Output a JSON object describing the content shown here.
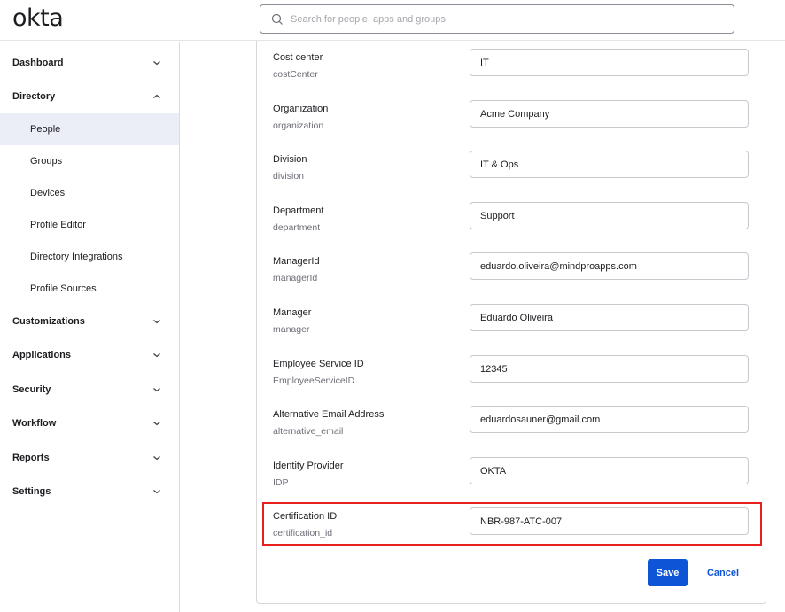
{
  "header": {
    "logo_text": "okta",
    "search": {
      "placeholder": "Search for people, apps and groups",
      "value": ""
    }
  },
  "sidebar": {
    "sections": [
      {
        "label": "Dashboard",
        "expanded": false,
        "icon": "chevron-down-icon"
      },
      {
        "label": "Directory",
        "expanded": true,
        "icon": "chevron-up-icon",
        "items": [
          {
            "label": "People",
            "active": true
          },
          {
            "label": "Groups"
          },
          {
            "label": "Devices"
          },
          {
            "label": "Profile Editor"
          },
          {
            "label": "Directory Integrations"
          },
          {
            "label": "Profile Sources"
          }
        ]
      },
      {
        "label": "Customizations",
        "expanded": false,
        "icon": "chevron-down-icon"
      },
      {
        "label": "Applications",
        "expanded": false,
        "icon": "chevron-down-icon"
      },
      {
        "label": "Security",
        "expanded": false,
        "icon": "chevron-down-icon"
      },
      {
        "label": "Workflow",
        "expanded": false,
        "icon": "chevron-down-icon"
      },
      {
        "label": "Reports",
        "expanded": false,
        "icon": "chevron-down-icon"
      },
      {
        "label": "Settings",
        "expanded": false,
        "icon": "chevron-down-icon"
      }
    ]
  },
  "form": {
    "fields": [
      {
        "label": "Cost center",
        "attribute": "costCenter",
        "value": "IT"
      },
      {
        "label": "Organization",
        "attribute": "organization",
        "value": "Acme Company"
      },
      {
        "label": "Division",
        "attribute": "division",
        "value": "IT & Ops"
      },
      {
        "label": "Department",
        "attribute": "department",
        "value": "Support"
      },
      {
        "label": "ManagerId",
        "attribute": "managerId",
        "value": "eduardo.oliveira@mindproapps.com"
      },
      {
        "label": "Manager",
        "attribute": "manager",
        "value": "Eduardo Oliveira"
      },
      {
        "label": "Employee Service ID",
        "attribute": "EmployeeServiceID",
        "value": "12345"
      },
      {
        "label": "Alternative Email Address",
        "attribute": "alternative_email",
        "value": "eduardosauner@gmail.com"
      },
      {
        "label": "Identity Provider",
        "attribute": "IDP",
        "value": "OKTA"
      },
      {
        "label": "Certification ID",
        "attribute": "certification_id",
        "value": "NBR-987-ATC-007",
        "highlighted": true
      }
    ],
    "save_label": "Save",
    "cancel_label": "Cancel"
  },
  "colors": {
    "primary": "#0e54d6",
    "highlight": "#e8201c",
    "active_nav_bg": "#ebedf7"
  }
}
